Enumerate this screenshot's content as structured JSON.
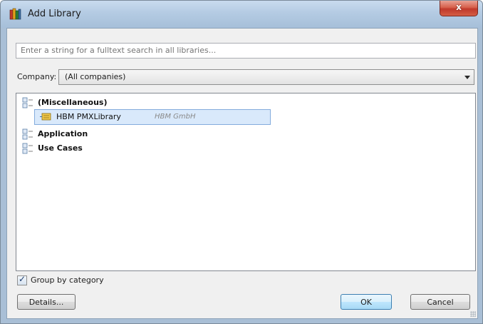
{
  "window": {
    "title": "Add Library",
    "close_label": "x"
  },
  "search": {
    "placeholder": "Enter a string for a fulltext search in all libraries..."
  },
  "company": {
    "label": "Company:",
    "selected": "(All companies)"
  },
  "tree": {
    "categories": [
      {
        "label": "(Miscellaneous)",
        "expanded": true
      },
      {
        "label": "Application",
        "expanded": false
      },
      {
        "label": "Use Cases",
        "expanded": false
      }
    ],
    "selected_library": {
      "name": "HBM PMXLibrary",
      "company": "HBM GmbH"
    }
  },
  "group_by": {
    "label": "Group by category",
    "checked": true
  },
  "buttons": {
    "details": "Details...",
    "ok": "OK",
    "cancel": "Cancel"
  },
  "colors": {
    "title_bar": "#b4cbe3",
    "close_button": "#c0392b",
    "selection_bg": "#d9e9fb",
    "selection_border": "#84acdd",
    "ok_button": "#bee6fd"
  },
  "icons": {
    "title": "library-books-icon",
    "category": "category-node-icon",
    "library": "library-item-icon",
    "dropdown": "chevron-down-icon",
    "check": "checkmark-icon"
  }
}
